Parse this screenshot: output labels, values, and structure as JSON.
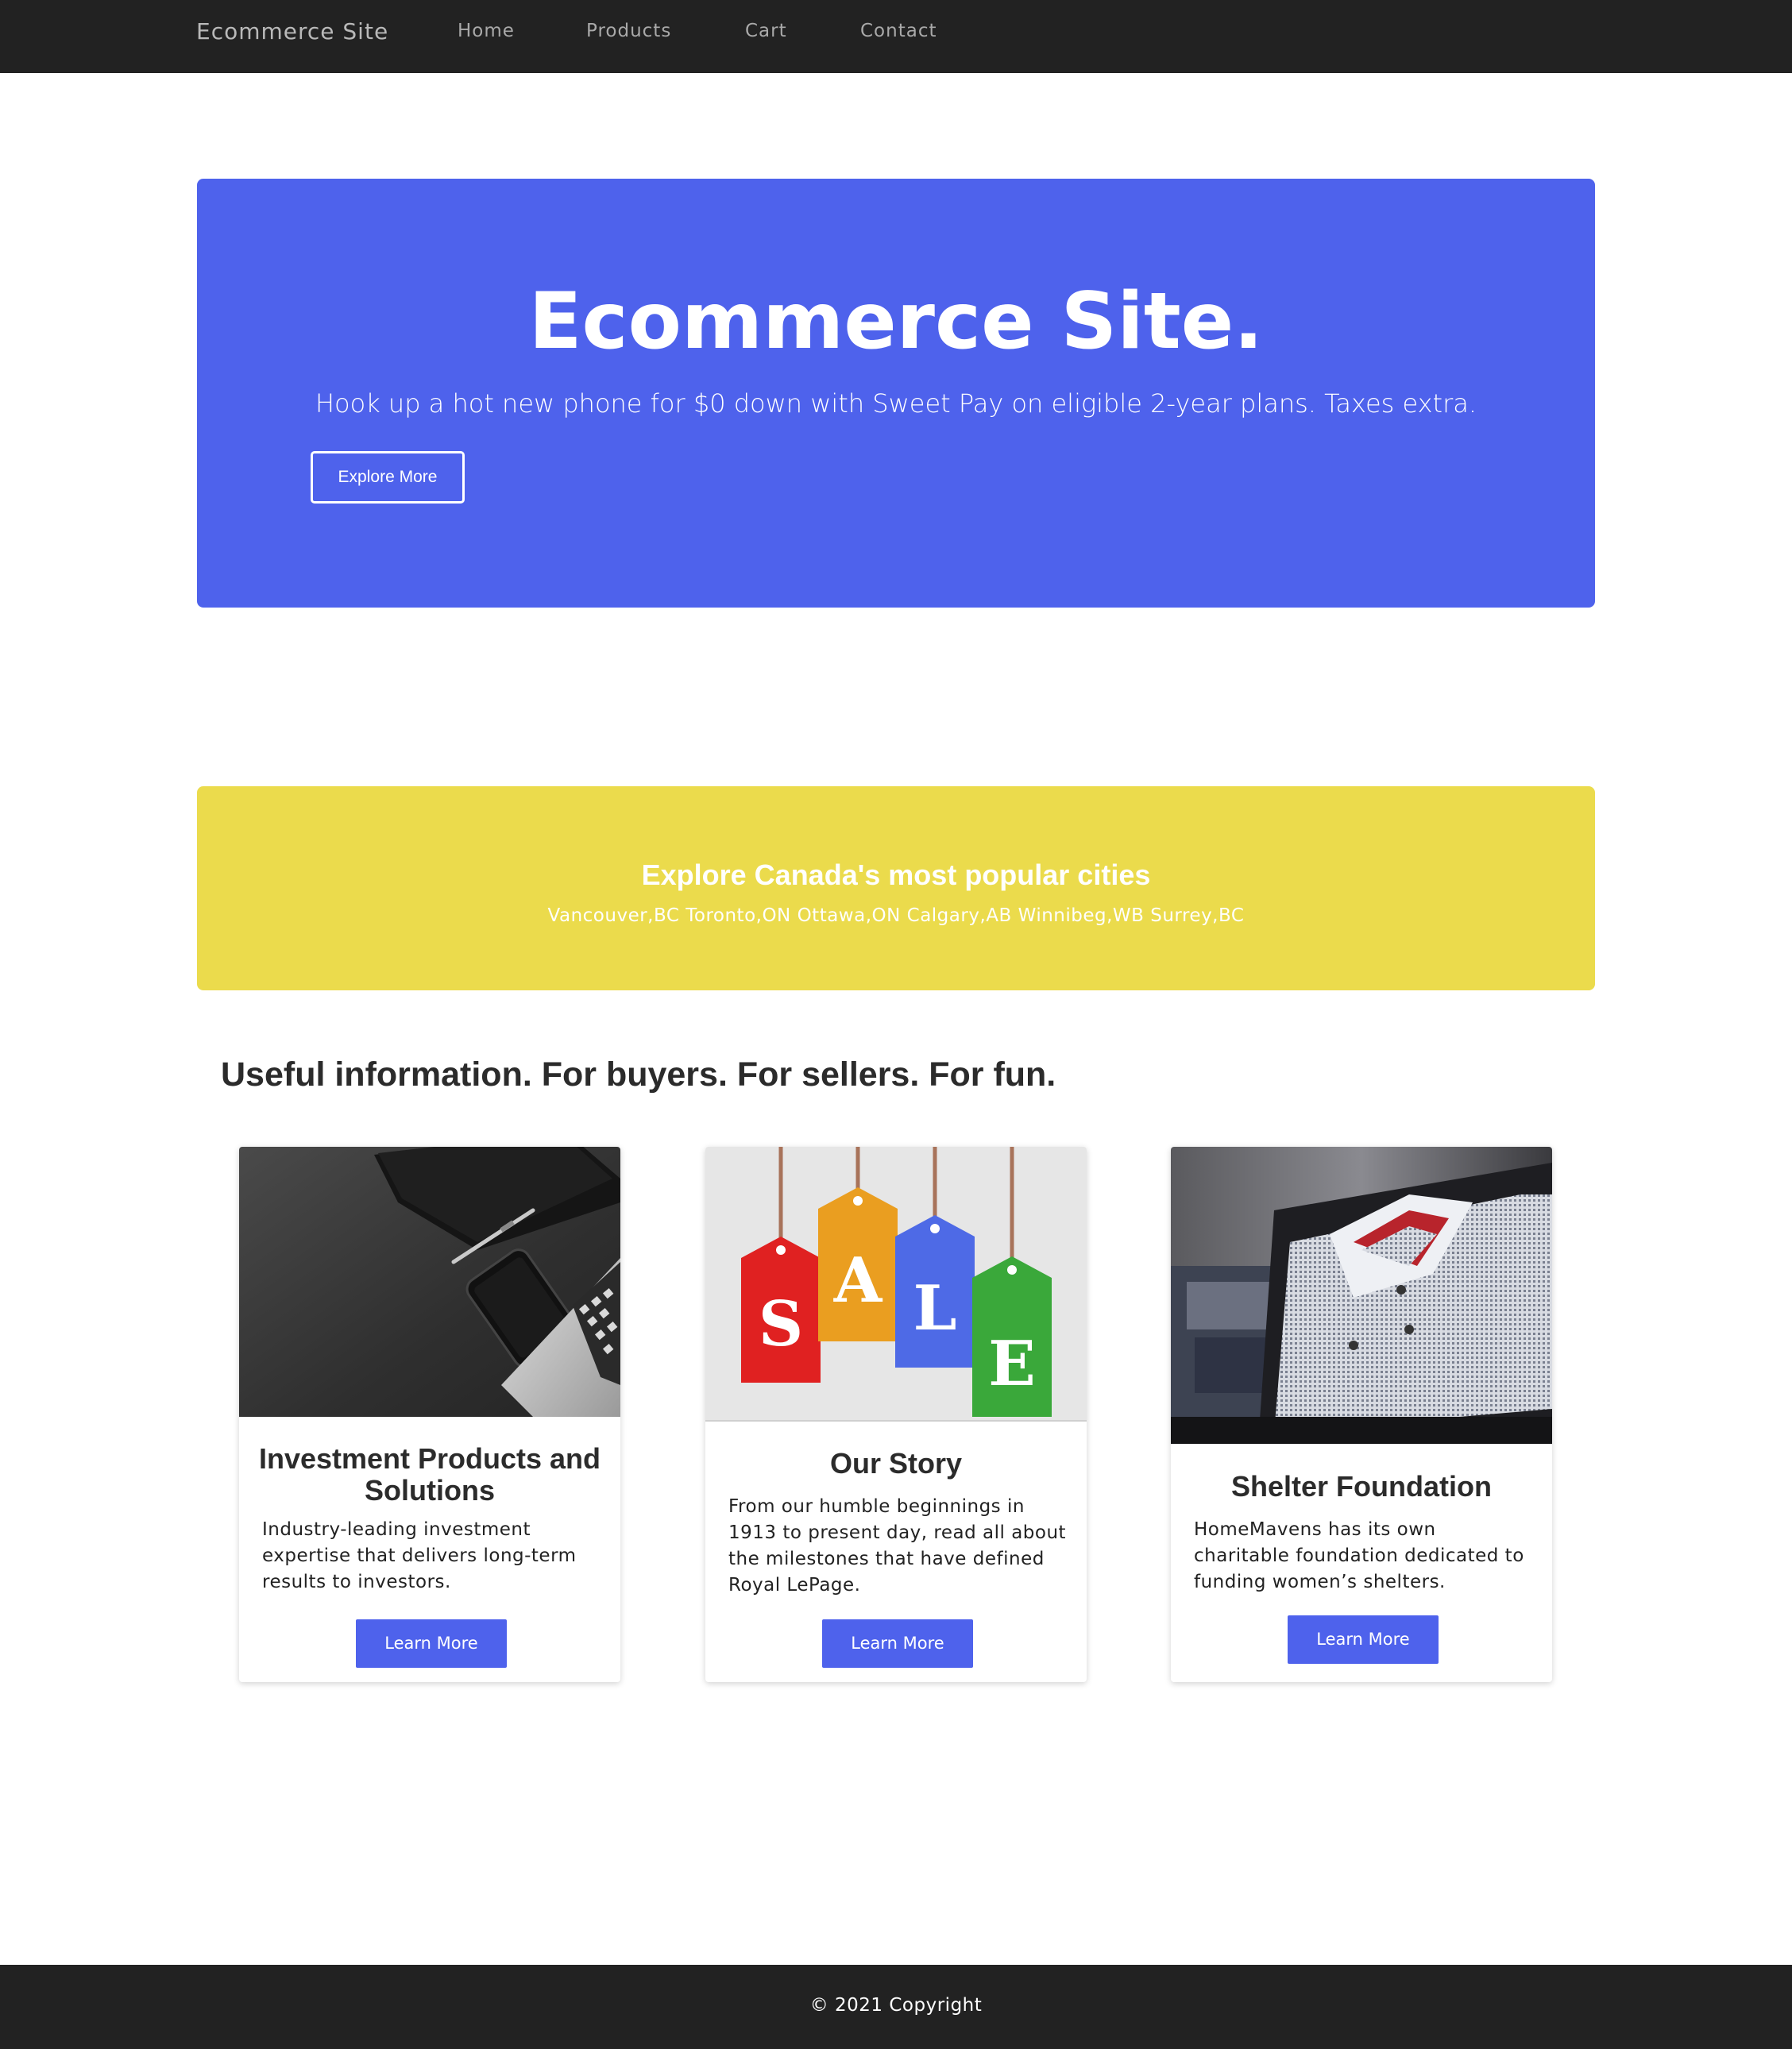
{
  "navbar": {
    "brand": "Ecommerce Site",
    "links": [
      "Home",
      "Products",
      "Cart",
      "Contact"
    ]
  },
  "hero": {
    "title": "Ecommerce Site.",
    "subtitle": "Hook up a hot new phone for $0 down with Sweet Pay on eligible 2-year plans. Taxes extra.",
    "button_label": "Explore More"
  },
  "cities": {
    "title": "Explore Canada's most popular cities",
    "list": "Vancouver,BC Toronto,ON Ottawa,ON Calgary,AB Winnibeg,WB Surrey,BC"
  },
  "section": {
    "heading": "Useful information. For buyers. For sellers. For fun."
  },
  "cards": [
    {
      "image": "laptop-phone-notebook-image",
      "title": "Investment Products and Solutions",
      "text": "Industry-leading investment expertise that delivers long-term results to investors.",
      "button_label": "Learn More"
    },
    {
      "image": "sale-tags-image",
      "title": "Our Story",
      "text": "From our humble beginnings in 1913 to present day, read all about the milestones that have defined Royal LePage.",
      "button_label": "Learn More"
    },
    {
      "image": "folded-shirts-image",
      "title": "Shelter Foundation",
      "text": "HomeMavens has its own charitable foundation dedicated to funding women’s shelters.",
      "button_label": "Learn More"
    }
  ],
  "sale_letters": [
    "S",
    "A",
    "L",
    "E"
  ],
  "footer": {
    "text": "© 2021 Copyright"
  },
  "colors": {
    "navbar": "#222222",
    "hero": "#4e62ec",
    "cities": "#ebdb4c",
    "button": "#4e62ec",
    "footer": "#222222"
  }
}
